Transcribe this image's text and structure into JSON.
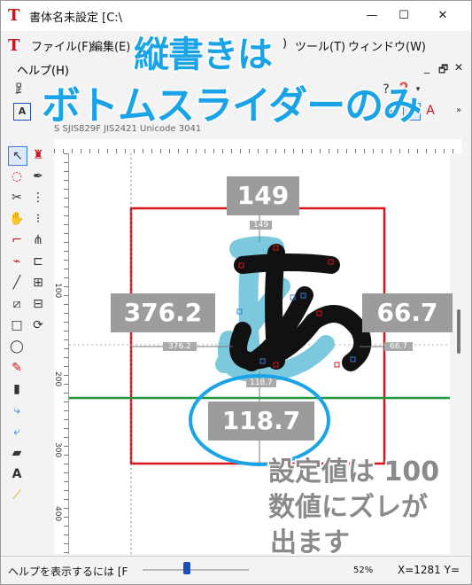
{
  "window": {
    "title": "書体名未設定 [C:\\",
    "minimize_glyph": "—",
    "maximize_glyph": "☐",
    "close_glyph": "✕"
  },
  "menu": {
    "items": [
      "ファイル(F)",
      "編集(E)",
      ")",
      "ツール(T)",
      "ウィンドウ(W)"
    ],
    "help": "ヘルプ(H)",
    "mdi": [
      "_",
      "🗗",
      "✕"
    ]
  },
  "overlay": {
    "headline_line1": "縦書きは",
    "headline_line2": "ボトムスライダーのみ",
    "callout_top": "149",
    "callout_left": "376.2",
    "callout_right": "66.7",
    "callout_bottom": "118.7",
    "note_lines": [
      "設定値は 100",
      "数値にズレが",
      "出ます"
    ]
  },
  "info_strip": "S  SJIS829F   JIS2421   Unicode 3041",
  "guides": {
    "top_small": "149",
    "left_small": "376.2",
    "right_small": "66.7",
    "bottom_small": "118.7"
  },
  "ruler_left_labels": [
    "100",
    "200",
    "300",
    "400"
  ],
  "status": {
    "help_text": "ヘルプを表示するには [F",
    "zoom": "52%",
    "coord": "X=1281 Y="
  },
  "colors": {
    "headline": "#1aa3e6",
    "callout_bg": "#9c9c9c",
    "frame_red": "#d9141c",
    "baseline_green": "#1e9a3c",
    "glyph_shadow": "#7cc8dc",
    "ellipse_blue": "#1aa3e6"
  }
}
